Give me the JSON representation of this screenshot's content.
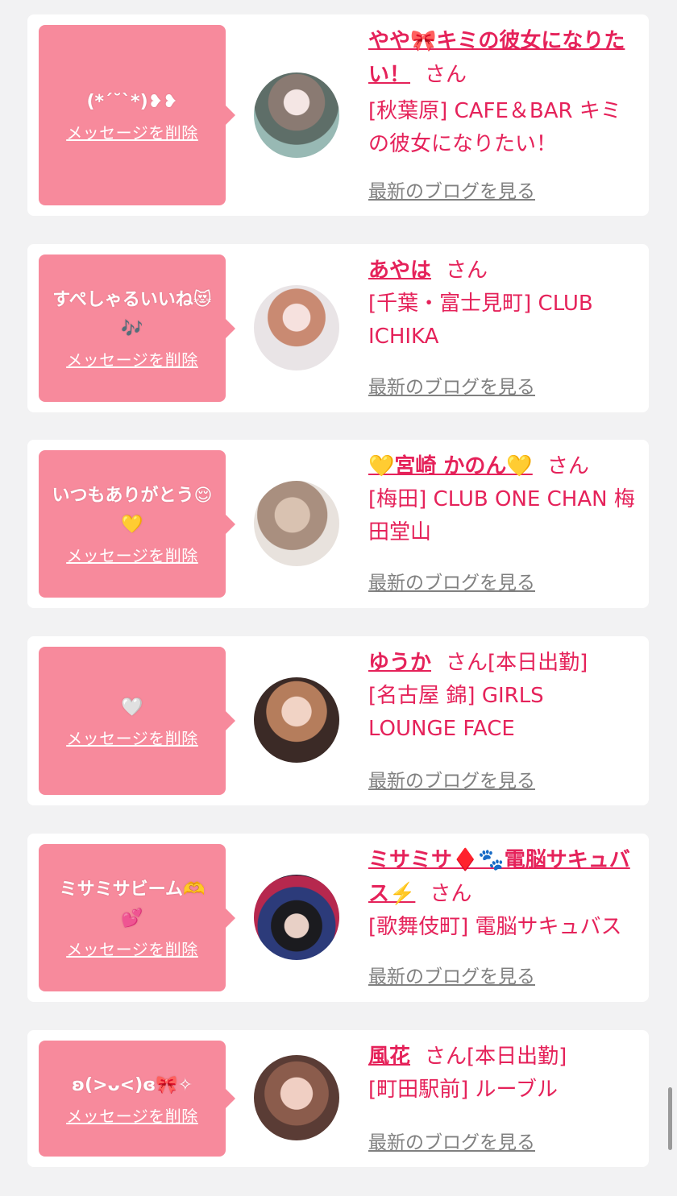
{
  "delete_label": "メッセージを削除",
  "blog_label": "最新のブログを見る",
  "san_label": "さん",
  "cards": [
    {
      "message": "(*´˘`*)❥❥",
      "name": "やや🎀キミの彼女になりたい！",
      "name_line2": "たい！",
      "shop": "[秋葉原] CAFE＆BAR キミの彼女になりたい！",
      "working": ""
    },
    {
      "message": "すぺしゃるいいね😻🎶",
      "name": "あやは",
      "shop": "[千葉・富士見町] CLUB ICHIKA",
      "working": ""
    },
    {
      "message": "いつもありがとう😌💛",
      "name": "💛宮崎 かのん💛",
      "shop": "[梅田] CLUB ONE CHAN 梅田堂山",
      "working": ""
    },
    {
      "message": "🤍",
      "name": "ゆうか",
      "shop": "[名古屋 錦] GIRLS LOUNGE FACE",
      "working": "[本日出勤]"
    },
    {
      "message": "ミサミサビーム🫶💕",
      "name": "ミサミサ♦️🐾電脳サキュバス⚡️",
      "shop": "[歌舞伎町] 電脳サキュバス",
      "working": ""
    },
    {
      "message": "ʚ(>ᴗ<)ɞ🎀✧",
      "name": "風花",
      "shop": "[町田駅前] ルーブル",
      "working": "[本日出勤]"
    }
  ]
}
